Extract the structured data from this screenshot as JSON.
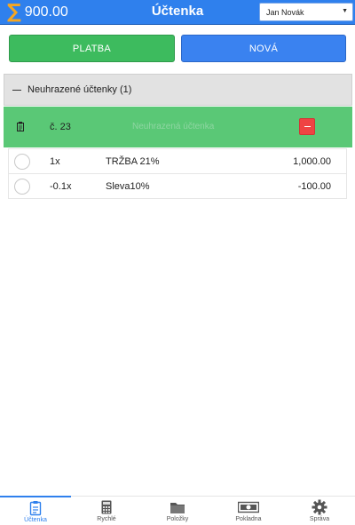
{
  "header": {
    "sigma": "∑",
    "total": "900.00",
    "title": "Účtenka",
    "user": "Jan Novák"
  },
  "actions": {
    "pay_label": "PLATBA",
    "new_label": "NOVÁ"
  },
  "unpaid": {
    "section_title": "Neuhrazené účtenky (1)",
    "receipt": {
      "number": "č. 23",
      "status": "Neuhrazená účtenka",
      "items": [
        {
          "qty": "1x",
          "name": "TRŽBA 21%",
          "price": "1,000.00"
        },
        {
          "qty": "-0.1x",
          "name": "Sleva10%",
          "price": "-100.00"
        }
      ]
    }
  },
  "nav": [
    {
      "label": "Účtenka",
      "icon": "receipt-icon",
      "active": true
    },
    {
      "label": "Rychlé",
      "icon": "calculator-icon",
      "active": false
    },
    {
      "label": "Položky",
      "icon": "folder-icon",
      "active": false
    },
    {
      "label": "Pokladna",
      "icon": "cash-icon",
      "active": false
    },
    {
      "label": "Správa",
      "icon": "gear-icon",
      "active": false
    }
  ],
  "colors": {
    "primary": "#2f80ed",
    "sigma": "#f5a623",
    "pay": "#3dbb5e",
    "receipt_row": "#5ac876",
    "delete": "#ef4343"
  }
}
